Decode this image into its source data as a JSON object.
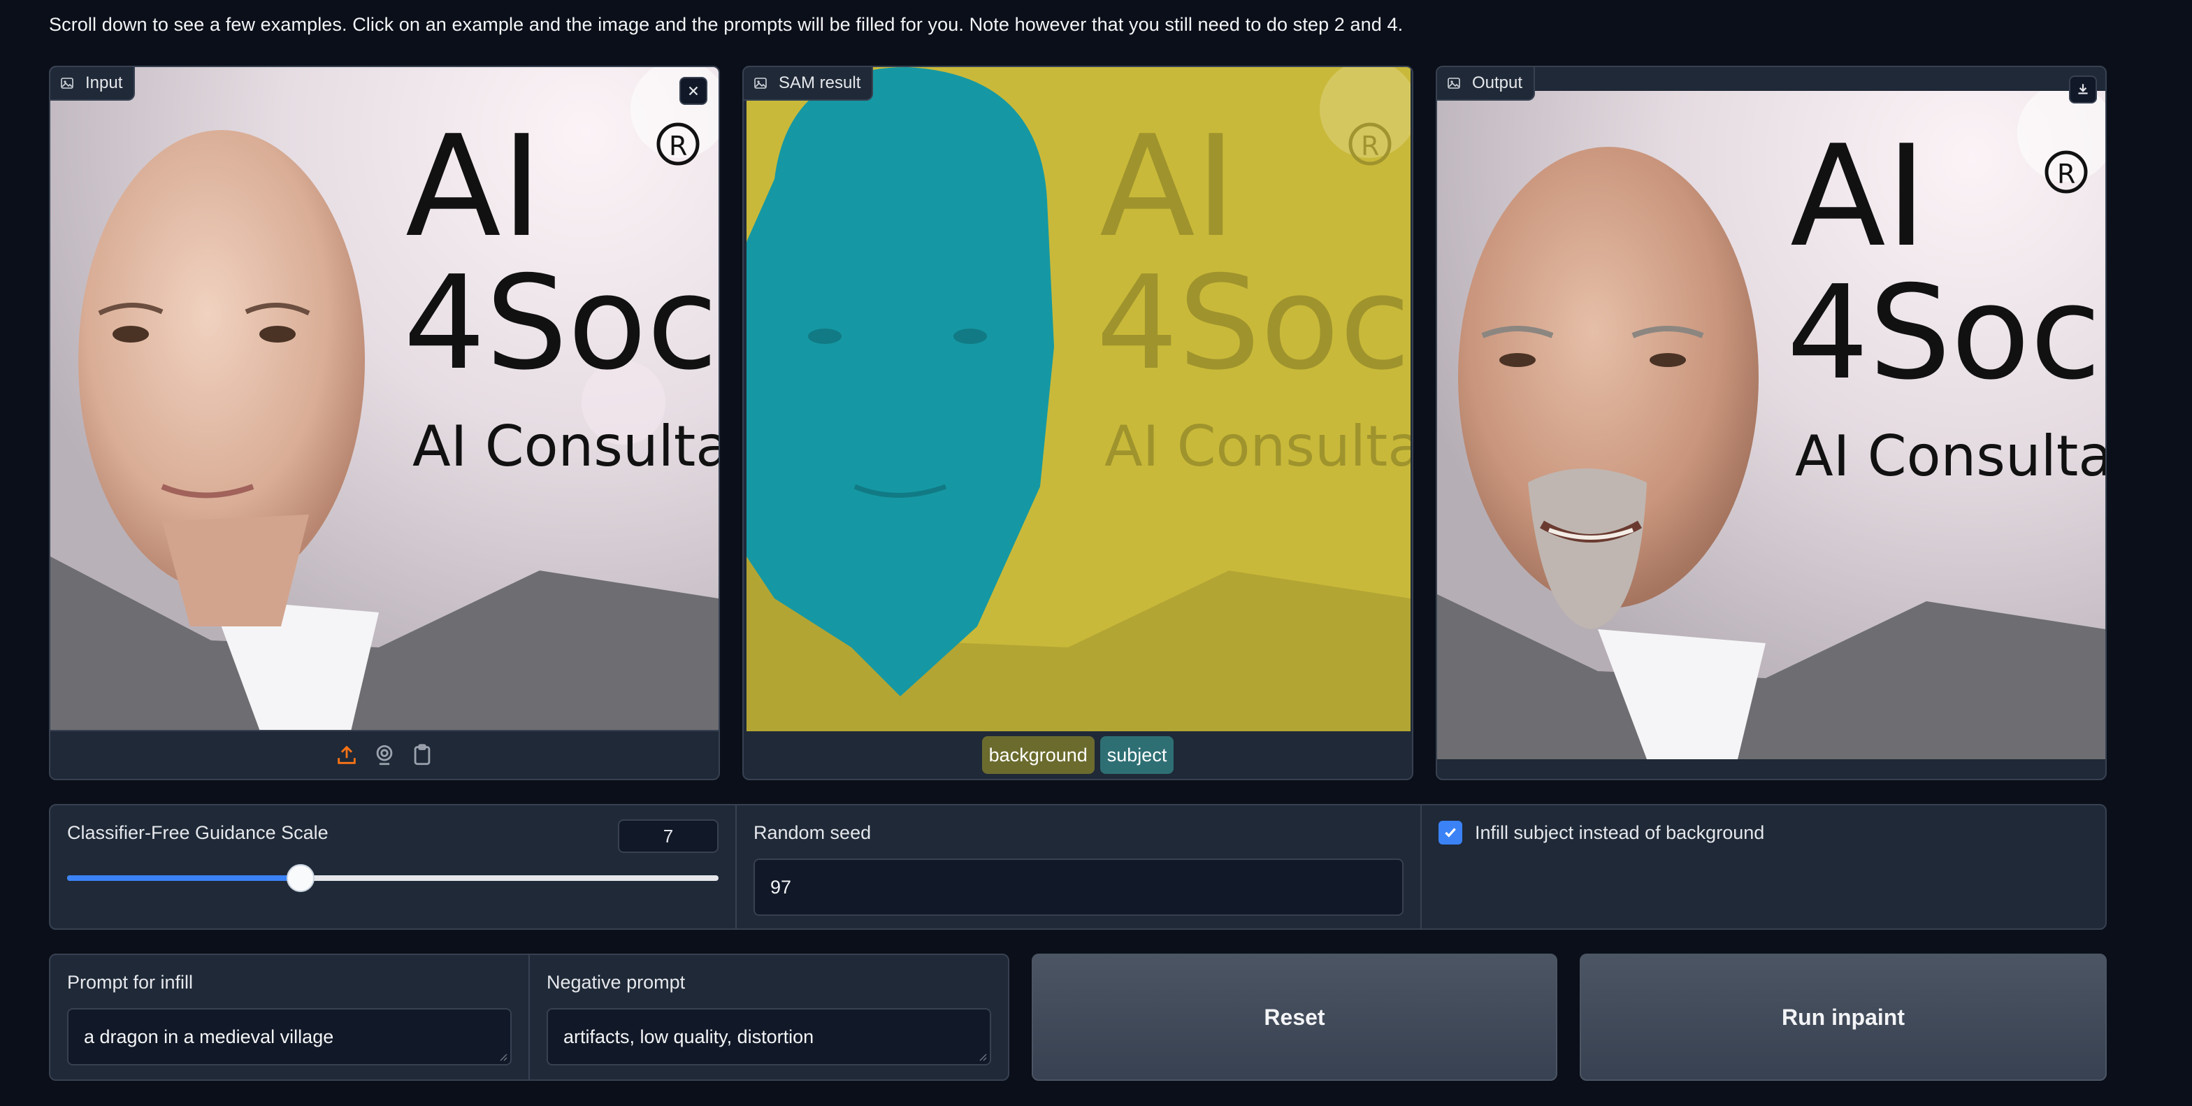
{
  "intro_text": "Scroll down to see a few examples. Click on an example and the image and the prompts will be filled for you. Note however that you still need to do step 2 and 4.",
  "panels": {
    "input": {
      "label": "Input",
      "logo_lines": [
        "AI",
        "4Soc",
        "AI  Consultant"
      ],
      "registered_mark": "®"
    },
    "sam": {
      "label": "SAM result",
      "legend": [
        {
          "label": "background",
          "color": "#6b6b2e"
        },
        {
          "label": "subject",
          "color": "#2e6f74"
        }
      ],
      "mask_colors": {
        "background": "#c9b93a",
        "subject": "#1598a3"
      }
    },
    "output": {
      "label": "Output"
    }
  },
  "controls": {
    "cfg": {
      "label": "Classifier-Free Guidance Scale",
      "value": "7",
      "level": 0.358
    },
    "seed": {
      "label": "Random seed",
      "value": "97"
    },
    "infill": {
      "label": "Infill subject instead of background",
      "checked": true
    }
  },
  "prompts": {
    "infill": {
      "label": "Prompt for infill",
      "value": "a dragon in a medieval village"
    },
    "negative": {
      "label": "Negative prompt",
      "value": "artifacts, low quality, distortion"
    }
  },
  "buttons": {
    "reset": "Reset",
    "run": "Run inpaint"
  },
  "colors": {
    "background": "#0b0f19",
    "panel": "#1f2937",
    "border": "#374151",
    "accent": "#3b82f6",
    "upload_icon": "#f97316"
  },
  "icons": [
    "image-icon",
    "close-icon",
    "upload-icon",
    "webcam-icon",
    "clipboard-icon",
    "download-icon",
    "check-icon"
  ]
}
